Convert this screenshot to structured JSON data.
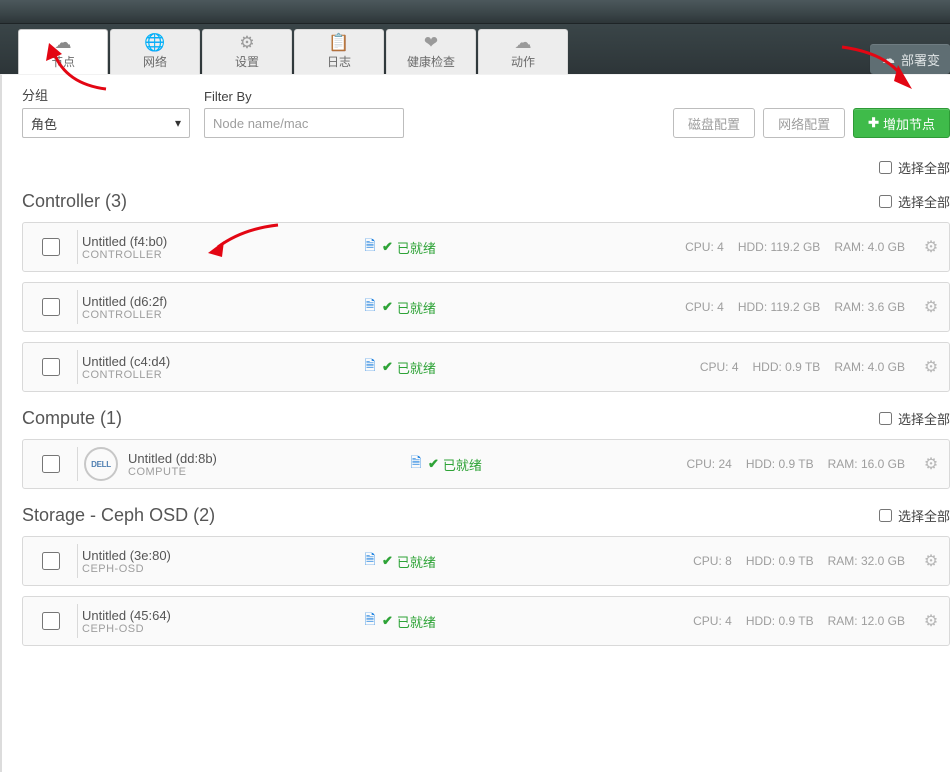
{
  "header": {
    "deploy_label": "部署变"
  },
  "tabs": [
    {
      "icon": "☁",
      "label": "节点",
      "active": true
    },
    {
      "icon": "🌐",
      "label": "网络",
      "active": false
    },
    {
      "icon": "⚙",
      "label": "设置",
      "active": false
    },
    {
      "icon": "📋",
      "label": "日志",
      "active": false
    },
    {
      "icon": "❤",
      "label": "健康检查",
      "active": false
    },
    {
      "icon": "☁",
      "label": "动作",
      "active": false
    }
  ],
  "filter": {
    "group_label": "分组",
    "group_value": "角色",
    "filterby_label": "Filter By",
    "placeholder": "Node name/mac"
  },
  "buttons": {
    "disk": "磁盘配置",
    "network": "网络配置",
    "add": "增加节点"
  },
  "selectall_label": "选择全部",
  "groups": [
    {
      "title": "Controller (3)",
      "nodes": [
        {
          "name": "Untitled (f4:b0)",
          "role": "CONTROLLER",
          "status": "已就绪",
          "cpu": "CPU: 4",
          "hdd": "HDD: 119.2 GB",
          "ram": "RAM: 4.0 GB",
          "logo": ""
        },
        {
          "name": "Untitled (d6:2f)",
          "role": "CONTROLLER",
          "status": "已就绪",
          "cpu": "CPU: 4",
          "hdd": "HDD: 119.2 GB",
          "ram": "RAM: 3.6 GB",
          "logo": ""
        },
        {
          "name": "Untitled (c4:d4)",
          "role": "CONTROLLER",
          "status": "已就绪",
          "cpu": "CPU: 4",
          "hdd": "HDD: 0.9 TB",
          "ram": "RAM: 4.0 GB",
          "logo": ""
        }
      ]
    },
    {
      "title": "Compute (1)",
      "nodes": [
        {
          "name": "Untitled (dd:8b)",
          "role": "COMPUTE",
          "status": "已就绪",
          "cpu": "CPU: 24",
          "hdd": "HDD: 0.9 TB",
          "ram": "RAM: 16.0 GB",
          "logo": "DELL"
        }
      ]
    },
    {
      "title": "Storage - Ceph OSD (2)",
      "nodes": [
        {
          "name": "Untitled (3e:80)",
          "role": "CEPH-OSD",
          "status": "已就绪",
          "cpu": "CPU: 8",
          "hdd": "HDD: 0.9 TB",
          "ram": "RAM: 32.0 GB",
          "logo": ""
        },
        {
          "name": "Untitled (45:64)",
          "role": "CEPH-OSD",
          "status": "已就绪",
          "cpu": "CPU: 4",
          "hdd": "HDD: 0.9 TB",
          "ram": "RAM: 12.0 GB",
          "logo": ""
        }
      ]
    }
  ]
}
